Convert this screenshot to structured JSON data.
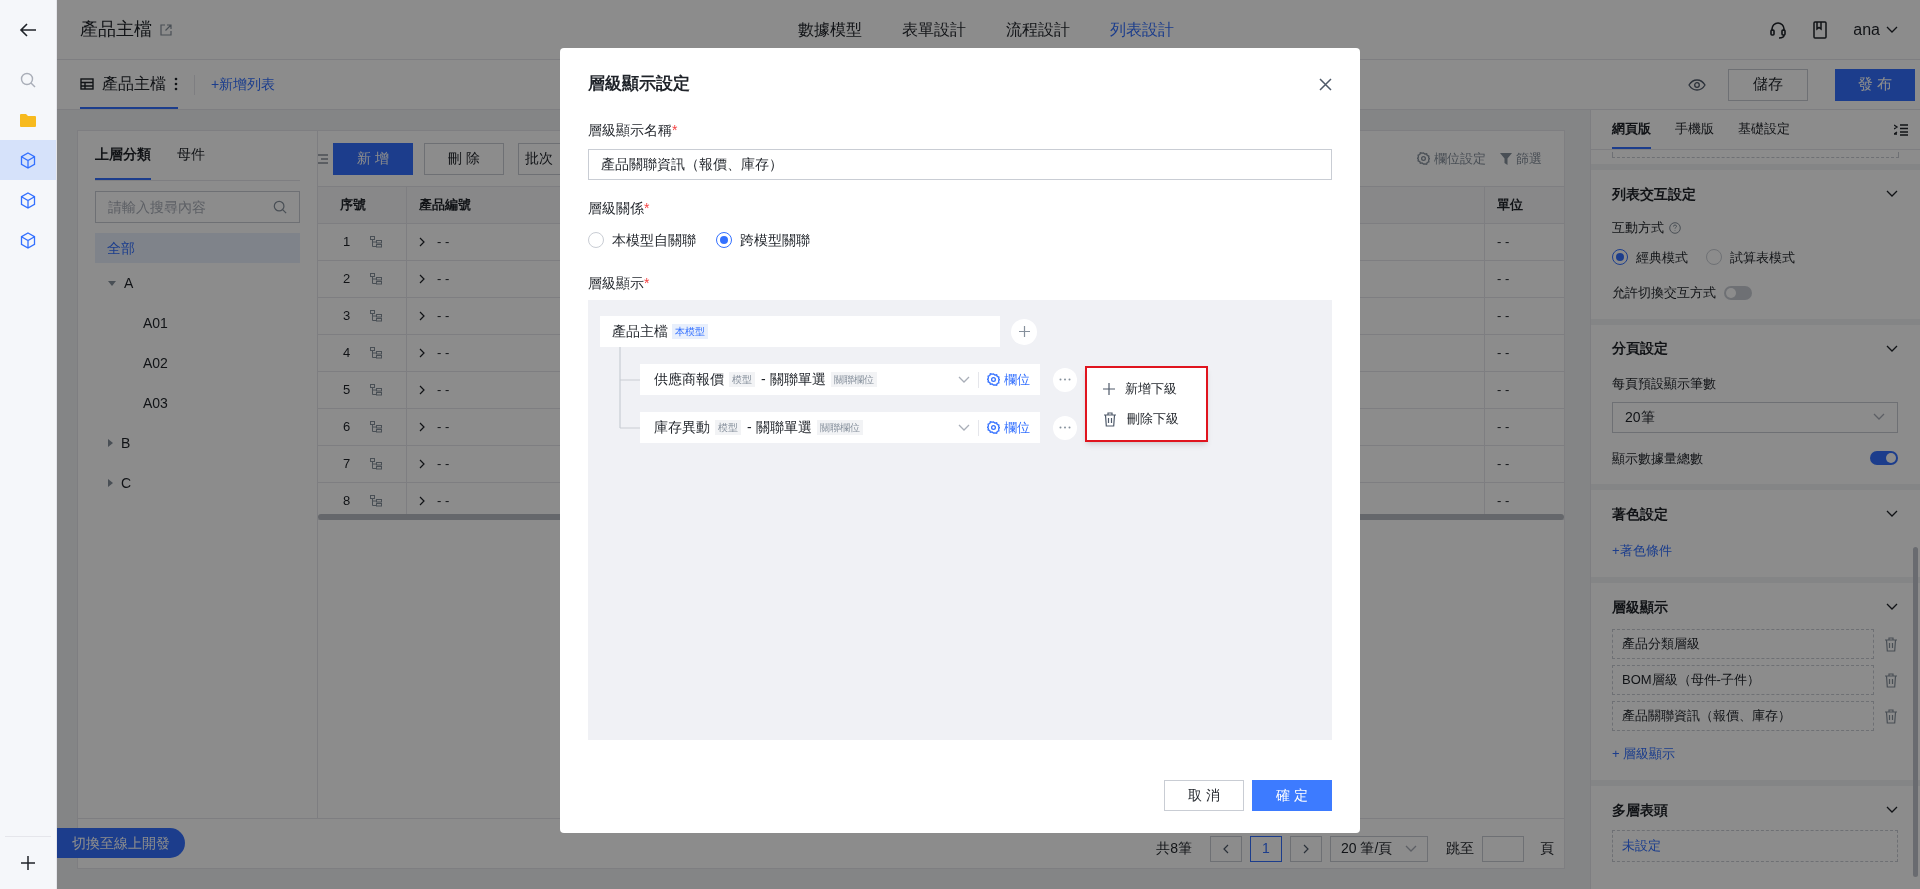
{
  "sidebar": {
    "nav": [
      {
        "kind": "search",
        "selected": false
      },
      {
        "kind": "folder",
        "selected": false
      },
      {
        "kind": "cube",
        "selected": true
      },
      {
        "kind": "cube",
        "selected": false
      },
      {
        "kind": "cube",
        "selected": false
      }
    ]
  },
  "header": {
    "title": "產品主檔",
    "tabs": [
      {
        "label": "數據模型",
        "selected": false
      },
      {
        "label": "表單設計",
        "selected": false
      },
      {
        "label": "流程設計",
        "selected": false
      },
      {
        "label": "列表設計",
        "selected": true
      }
    ],
    "user": "ana"
  },
  "list_bar": {
    "list_name": "產品主檔",
    "add_list": "+新增列表",
    "save": "儲存",
    "publish": "發 布"
  },
  "category_panel": {
    "tabs": [
      {
        "label": "上層分類",
        "selected": true
      },
      {
        "label": "母件",
        "selected": false
      }
    ],
    "search_placeholder": "請輸入搜尋內容",
    "tree": [
      {
        "label": "全部",
        "selected": true
      },
      {
        "label": "A",
        "selected": false,
        "expanded": true,
        "children": [
          {
            "label": "A01",
            "selected": false
          },
          {
            "label": "A02",
            "selected": false
          },
          {
            "label": "A03",
            "selected": false
          }
        ]
      },
      {
        "label": "B",
        "selected": false,
        "expanded": false
      },
      {
        "label": "C",
        "selected": false,
        "expanded": false
      }
    ]
  },
  "table": {
    "buttons": [
      {
        "kind": "primary",
        "label": "新 增"
      },
      {
        "kind": "default",
        "label": "刪 除"
      },
      {
        "kind": "default",
        "label": "批次"
      }
    ],
    "tools": [
      {
        "kind": "columns",
        "label": "欄位設定"
      },
      {
        "kind": "filter",
        "label": "篩選"
      }
    ],
    "columns": [
      "序號",
      "產品編號",
      "單位"
    ],
    "rows": [
      {
        "index": "1",
        "code": "- -",
        "unit": "- -"
      },
      {
        "index": "2",
        "code": "- -",
        "unit": "- -"
      },
      {
        "index": "3",
        "code": "- -",
        "unit": "- -"
      },
      {
        "index": "4",
        "code": "- -",
        "unit": "- -"
      },
      {
        "index": "5",
        "code": "- -",
        "unit": "- -"
      },
      {
        "index": "6",
        "code": "- -",
        "unit": "- -"
      },
      {
        "index": "7",
        "code": "- -",
        "unit": "- -"
      },
      {
        "index": "8",
        "code": "- -",
        "unit": "- -"
      }
    ]
  },
  "pagination": {
    "total": "共8筆",
    "pages": [
      {
        "label": "1",
        "selected": true
      }
    ],
    "page_size": "20 筆/頁",
    "jump_label": "跳至",
    "page_unit": "頁"
  },
  "switch_button": "切換至線上開發",
  "settings": {
    "tabs": [
      {
        "label": "網頁版",
        "selected": true
      },
      {
        "label": "手機版",
        "selected": false
      },
      {
        "label": "基礎設定",
        "selected": false
      }
    ],
    "interaction": {
      "title": "列表交互設定",
      "mode_label": "互動方式",
      "modes": [
        {
          "label": "經典模式",
          "selected": true
        },
        {
          "label": "試算表模式",
          "selected": false
        }
      ],
      "allow_switch": {
        "label": "允許切換交互方式",
        "on": false
      }
    },
    "paging": {
      "title": "分頁設定",
      "label": "每頁預設顯示筆數",
      "value": "20筆",
      "show_total": {
        "label": "顯示數據量總數",
        "on": true
      }
    },
    "coloring": {
      "title": "著色設定",
      "add": "+著色條件"
    },
    "hierarchy": {
      "title": "層級顯示",
      "items": [
        "產品分類層級",
        "BOM層級（母件-子件）",
        "產品關聯資訊（報價、庫存）"
      ],
      "add": "+ 層級顯示"
    },
    "multi_header": {
      "title": "多層表頭",
      "value": "未設定"
    }
  },
  "modal": {
    "title": "層級顯示設定",
    "name_label": {
      "text": "層級顯示名稱",
      "mark": "*"
    },
    "name_value": "產品關聯資訊（報價、庫存）",
    "relation_label": {
      "text": "層級關係",
      "mark": "*"
    },
    "relations": [
      {
        "label": "本模型自關聯",
        "selected": false
      },
      {
        "label": "跨模型關聯",
        "selected": true
      }
    ],
    "display_label": {
      "text": "層級顯示",
      "mark": "*"
    },
    "root": {
      "name": "產品主檔",
      "tag": "本模型",
      "children": [
        {
          "name": "供應商報價",
          "model_tag": "模型",
          "relation": "- 關聯單選",
          "relation_tag": "關聯欄位",
          "fields": "欄位"
        },
        {
          "name": "庫存異動",
          "model_tag": "模型",
          "relation": "- 關聯單選",
          "relation_tag": "關聯欄位",
          "fields": "欄位"
        }
      ]
    },
    "menu": [
      {
        "kind": "add",
        "label": "新增下級"
      },
      {
        "kind": "delete",
        "label": "刪除下級"
      }
    ],
    "cancel": "取 消",
    "ok": "確 定"
  }
}
